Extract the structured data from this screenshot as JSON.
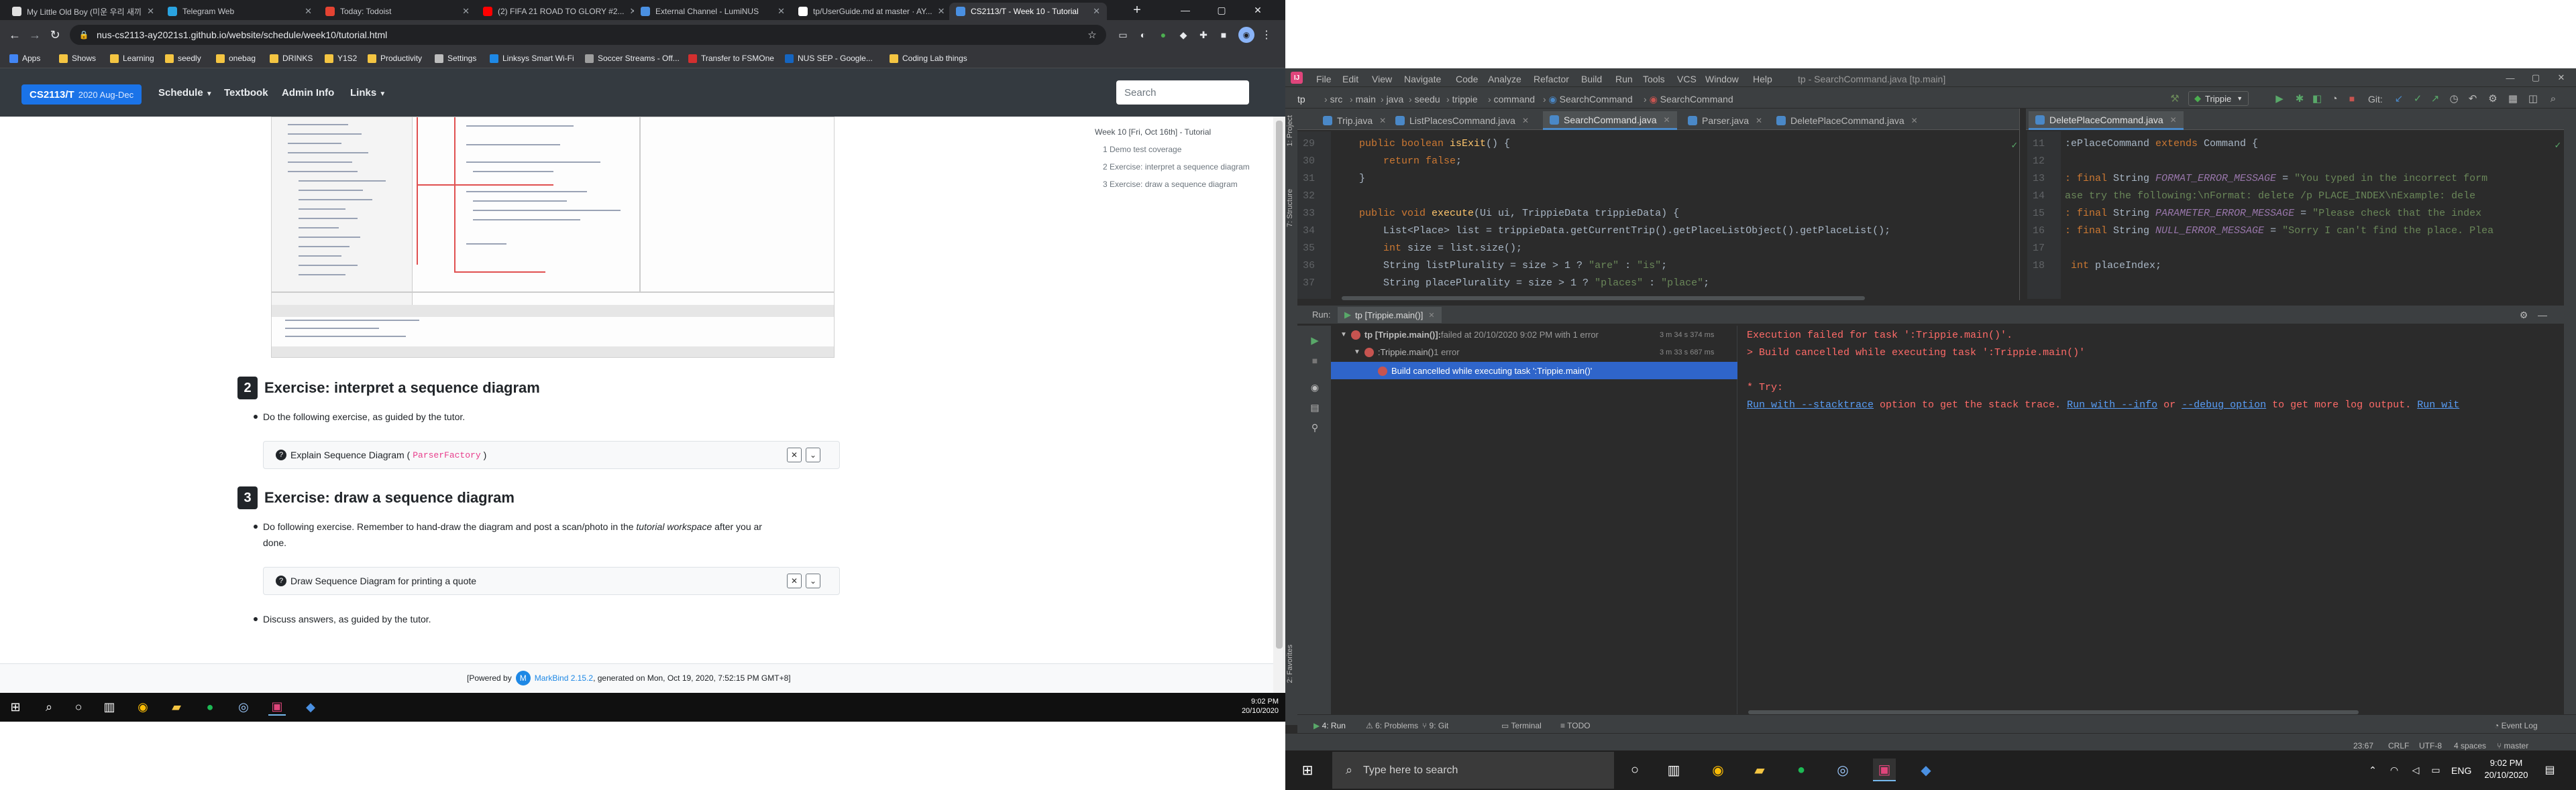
{
  "browser": {
    "tabs": [
      {
        "title": "My Little Old Boy (미운 우리 새끼",
        "color": "#e0e0e0"
      },
      {
        "title": "Telegram Web",
        "color": "#2aa3e0"
      },
      {
        "title": "Today: Todoist",
        "color": "#e44332"
      },
      {
        "title": "(2) FIFA 21 ROAD TO GLORY #2...",
        "color": "#ff0000"
      },
      {
        "title": "External Channel - LumiNUS",
        "color": "#4a90e2"
      },
      {
        "title": "tp/UserGuide.md at master · AY...",
        "color": "#ffffff"
      },
      {
        "title": "CS2113/T - Week 10 - Tutorial",
        "color": "#4a90e2"
      }
    ],
    "url": "nus-cs2113-ay2021s1.github.io/website/schedule/week10/tutorial.html",
    "bookmarks": [
      "Apps",
      "Shows",
      "Learning",
      "seedly",
      "onebag",
      "DRINKS",
      "Y1S2",
      "Productivity",
      "Settings",
      "Linksys Smart Wi-Fi",
      "Soccer Streams - Off...",
      "Transfer to FSMOne",
      "NUS SEP - Google...",
      "Coding Lab things"
    ]
  },
  "site": {
    "brand": "CS2113/T",
    "brand_sub": "2020 Aug-Dec",
    "nav": [
      "Schedule",
      "Textbook",
      "Admin Info",
      "Links"
    ],
    "search_placeholder": "Search"
  },
  "page": {
    "section2_num": "2",
    "section2_title": "Exercise: interpret a sequence diagram",
    "section2_bullet": "Do the following exercise, as guided by the tutor.",
    "panel1_label": "Explain Sequence Diagram (",
    "panel1_code": "ParserFactory",
    "panel1_end": ")",
    "section3_num": "3",
    "section3_title": "Exercise: draw a sequence diagram",
    "section3_bullet_a": "Do following exercise. Remember to hand-draw the diagram and post a scan/photo in the ",
    "section3_bullet_em": "tutorial workspace",
    "section3_bullet_b": " after you ar",
    "section3_bullet_c": "done.",
    "panel2_label": "Draw Sequence Diagram for printing a quote",
    "bullet_discuss": "Discuss answers, as guided by the tutor.",
    "footer_pre": "[Powered by",
    "footer_link": "MarkBind 2.15.2",
    "footer_post": ", generated on Mon, Oct 19, 2020, 7:52:15 PM GMT+8]"
  },
  "toc": {
    "title": "Week 10 [Fri, Oct 16th] - Tutorial",
    "items": [
      "1 Demo test coverage",
      "2 Exercise: interpret a sequence diagram",
      "3 Exercise: draw a sequence diagram"
    ]
  },
  "left_clock": {
    "time": "9:02 PM",
    "date": "20/10/2020"
  },
  "ide": {
    "menus": [
      "File",
      "Edit",
      "View",
      "Navigate",
      "Code",
      "Analyze",
      "Refactor",
      "Build",
      "Run",
      "Tools",
      "VCS",
      "Window",
      "Help"
    ],
    "window_title": "tp - SearchCommand.java [tp.main]",
    "breadcrumbs": [
      "tp",
      "src",
      "main",
      "java",
      "seedu",
      "trippie",
      "command",
      "SearchCommand",
      "SearchCommand"
    ],
    "run_config": "Trippie",
    "git_label": "Git:",
    "tabs_left": [
      "Trip.java",
      "ListPlacesCommand.java",
      "SearchCommand.java",
      "Parser.java",
      "DeletePlaceCommand.java"
    ],
    "tab_right": "DeletePlaceCommand.java",
    "left_code": [
      {
        "ln": "29",
        "parts": [
          [
            "kw",
            "    public boolean "
          ],
          [
            "fn",
            "isExit"
          ],
          [
            "tx",
            "() {"
          ]
        ]
      },
      {
        "ln": "30",
        "parts": [
          [
            "kw",
            "        return false"
          ],
          [
            "tx",
            ";"
          ]
        ]
      },
      {
        "ln": "31",
        "parts": [
          [
            "tx",
            "    }"
          ]
        ]
      },
      {
        "ln": "32",
        "parts": [
          [
            "tx",
            ""
          ]
        ]
      },
      {
        "ln": "33",
        "parts": [
          [
            "kw",
            "    public void "
          ],
          [
            "fn",
            "execute"
          ],
          [
            "tx",
            "(Ui ui, TrippieData trippieData) {"
          ]
        ]
      },
      {
        "ln": "34",
        "parts": [
          [
            "tx",
            "        List<Place> list = trippieData.getCurrentTrip().getPlaceListObject().getPlaceList();"
          ]
        ]
      },
      {
        "ln": "35",
        "parts": [
          [
            "kw",
            "        int "
          ],
          [
            "tx",
            "size = list.size();"
          ]
        ]
      },
      {
        "ln": "36",
        "parts": [
          [
            "tx",
            "        String listPlurality = size > 1 ? "
          ],
          [
            "str",
            "\"are\""
          ],
          [
            "tx",
            " : "
          ],
          [
            "str",
            "\"is\""
          ],
          [
            "tx",
            ";"
          ]
        ]
      },
      {
        "ln": "37",
        "parts": [
          [
            "tx",
            "        String placePlurality = size > 1 ? "
          ],
          [
            "str",
            "\"places\""
          ],
          [
            "tx",
            " : "
          ],
          [
            "str",
            "\"place\""
          ],
          [
            "tx",
            ";"
          ]
        ]
      }
    ],
    "right_code": [
      {
        "ln": "11",
        "parts": [
          [
            "tx",
            ":ePlaceCommand "
          ],
          [
            "kw",
            "extends "
          ],
          [
            "tx",
            "Command {"
          ]
        ]
      },
      {
        "ln": "12",
        "parts": [
          [
            "tx",
            ""
          ]
        ]
      },
      {
        "ln": "13",
        "parts": [
          [
            "kw",
            ": final "
          ],
          [
            "tx",
            "String "
          ],
          [
            "fld",
            "FORMAT_ERROR_MESSAGE"
          ],
          [
            "tx",
            " = "
          ],
          [
            "str",
            "\"You typed in the incorrect form"
          ]
        ]
      },
      {
        "ln": "14",
        "parts": [
          [
            "str",
            "ase try the following:\\nFormat: delete /p PLACE_INDEX\\nExample: dele"
          ]
        ]
      },
      {
        "ln": "15",
        "parts": [
          [
            "kw",
            ": final "
          ],
          [
            "tx",
            "String "
          ],
          [
            "fld",
            "PARAMETER_ERROR_MESSAGE"
          ],
          [
            "tx",
            " = "
          ],
          [
            "str",
            "\"Please check that the index"
          ]
        ]
      },
      {
        "ln": "16",
        "parts": [
          [
            "kw",
            ": final "
          ],
          [
            "tx",
            "String "
          ],
          [
            "fld",
            "NULL_ERROR_MESSAGE"
          ],
          [
            "tx",
            " = "
          ],
          [
            "str",
            "\"Sorry I can't find the place. Plea"
          ]
        ]
      },
      {
        "ln": "17",
        "parts": [
          [
            "tx",
            ""
          ]
        ]
      },
      {
        "ln": "18",
        "parts": [
          [
            "kw",
            " int "
          ],
          [
            "tx",
            "placeIndex;"
          ]
        ]
      }
    ],
    "run_label": "Run:",
    "run_tab": "tp [Trippie.main()]",
    "tree": [
      {
        "text": "tp [Trippie.main()]:",
        "suffix": " failed at 20/10/2020 9:02 PM with 1 error",
        "time": "3 m 34 s 374 ms"
      },
      {
        "text": ":Trippie.main()",
        "suffix": "  1 error",
        "time": "3 m 33 s 687 ms"
      },
      {
        "text": "Build cancelled while executing task ':Trippie.main()'",
        "suffix": "",
        "time": ""
      }
    ],
    "console": {
      "line1": "Execution failed for task ':Trippie.main()'.",
      "line2": "> Build cancelled while executing task ':Trippie.main()'",
      "line3": "* Try:",
      "line4_link1": "Run with --stacktrace",
      "line4_mid1": " option to get the stack trace. ",
      "line4_link2": "Run with --info",
      "line4_mid2": " or ",
      "line4_link3": "--debug option",
      "line4_mid3": " to get more log output. ",
      "line4_link4": "Run wit"
    },
    "bottom_tabs": [
      "4: Run",
      "6: Problems",
      "9: Git",
      "Terminal",
      "TODO"
    ],
    "event_log": "Event Log",
    "status": [
      "23:67",
      "CRLF",
      "UTF-8",
      "4 spaces",
      "master"
    ],
    "side_labels": [
      "1: Project",
      "7: Structure",
      "2: Favorites"
    ]
  },
  "right_taskbar": {
    "search_placeholder": "Type here to search",
    "lang": "ENG",
    "time": "9:02 PM",
    "date": "20/10/2020"
  }
}
